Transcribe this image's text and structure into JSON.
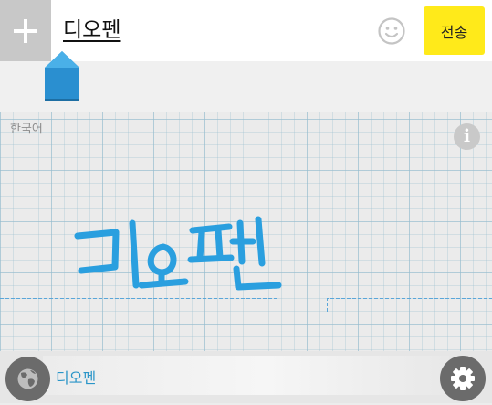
{
  "topbar": {
    "compose_text": "디오펜",
    "send_label": "전송",
    "plus_icon": "plus-icon",
    "emoji_icon": "smiley-icon",
    "accent_color": "#ffea1a"
  },
  "handwriting": {
    "language": "한국어",
    "info_label": "i",
    "ink_text": "디오펜",
    "ink_color": "#2a9fdf"
  },
  "bottombar": {
    "suggestion": "디오펜",
    "globe_icon": "globe-icon",
    "settings_icon": "gear-icon"
  }
}
